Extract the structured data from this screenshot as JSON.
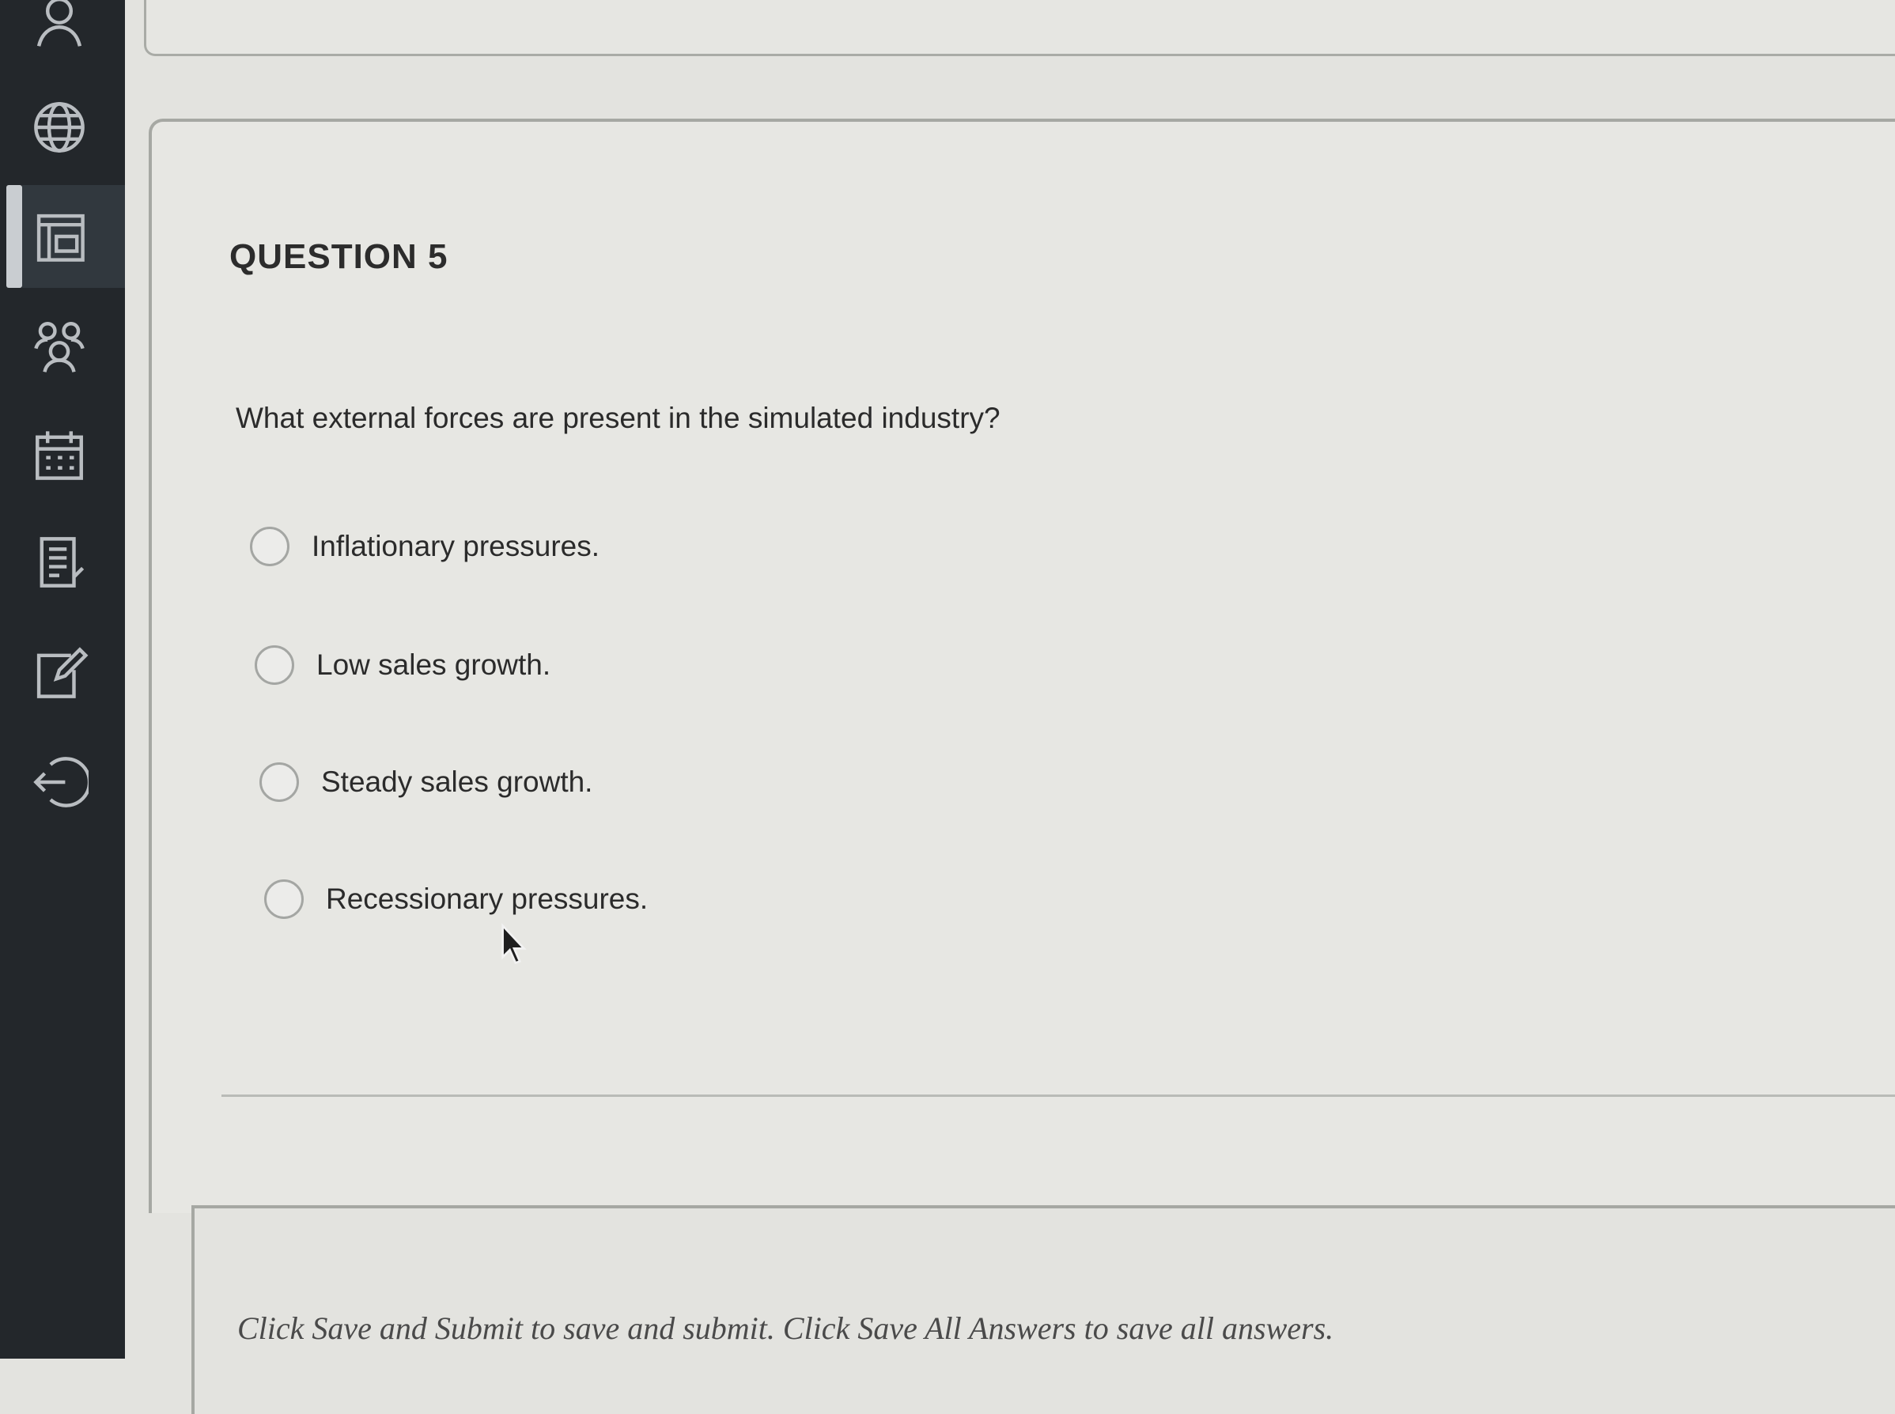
{
  "sidebar": {
    "icons": [
      "user-icon",
      "globe-icon",
      "course-icon",
      "groups-icon",
      "calendar-icon",
      "messages-icon",
      "grades-icon",
      "sign-out-icon"
    ],
    "active": "course-icon"
  },
  "question": {
    "title": "QUESTION 5",
    "text": "What external forces are present in the simulated industry?",
    "options": [
      {
        "label": "Inflationary pressures."
      },
      {
        "label": "Low sales growth."
      },
      {
        "label": "Steady sales growth."
      },
      {
        "label": "Recessionary pressures."
      }
    ]
  },
  "footer": {
    "instruction": "Click Save and Submit to save and submit. Click Save All Answers to save all answers."
  },
  "colors": {
    "sidebar": "#23272b",
    "page": "#e3e3df",
    "text": "#2b2b2b"
  }
}
